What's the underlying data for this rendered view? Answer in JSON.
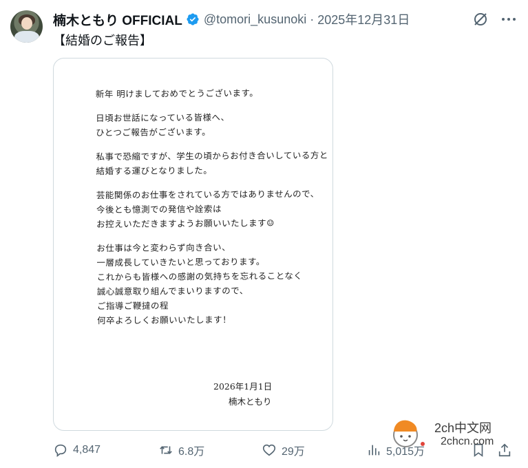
{
  "author": {
    "display_name": "楠木ともり OFFICIAL",
    "handle": "@tomori_kusunoki",
    "separator": "·",
    "date": "2025年12月31日"
  },
  "tweet": {
    "text": "【結婚のご報告】"
  },
  "letter": {
    "paragraphs": [
      [
        "新年 明けましておめでとうございます。"
      ],
      [
        "日頃お世話になっている皆様へ、",
        "ひとつご報告がございます。"
      ],
      [
        "私事で恐縮ですが、学生の頃からお付き合いしている方と",
        "結婚する運びとなりました。"
      ],
      [
        "芸能関係のお仕事をされている方ではありませんので、",
        "今後とも憶測での発信や詮索は",
        "お控えいただきますようお願いいたします☺"
      ],
      [
        "お仕事は今と変わらず向き合い、",
        "一層成長していきたいと思っております。",
        "これからも皆様への感謝の気持ちを忘れることなく",
        "誠心誠意取り組んでまいりますので、",
        "ご指導ご鞭撻の程",
        "何卒よろしくお願いいたします！"
      ]
    ],
    "sign_date": "2026年1月1日",
    "sign_name": "楠木ともり"
  },
  "actions": {
    "replies": "4,847",
    "reposts": "6.8万",
    "likes": "29万",
    "views": "5,015万"
  },
  "watermark": {
    "line1": "2ch中文网",
    "line2": "2chcn.com"
  },
  "colors": {
    "verified": "#1d9bf0",
    "muted": "#536471",
    "border": "#cfd9de"
  },
  "icons": [
    "verified-badge-icon",
    "grok-icon",
    "more-icon",
    "reply-icon",
    "repost-icon",
    "like-icon",
    "views-icon",
    "bookmark-icon",
    "share-icon"
  ]
}
